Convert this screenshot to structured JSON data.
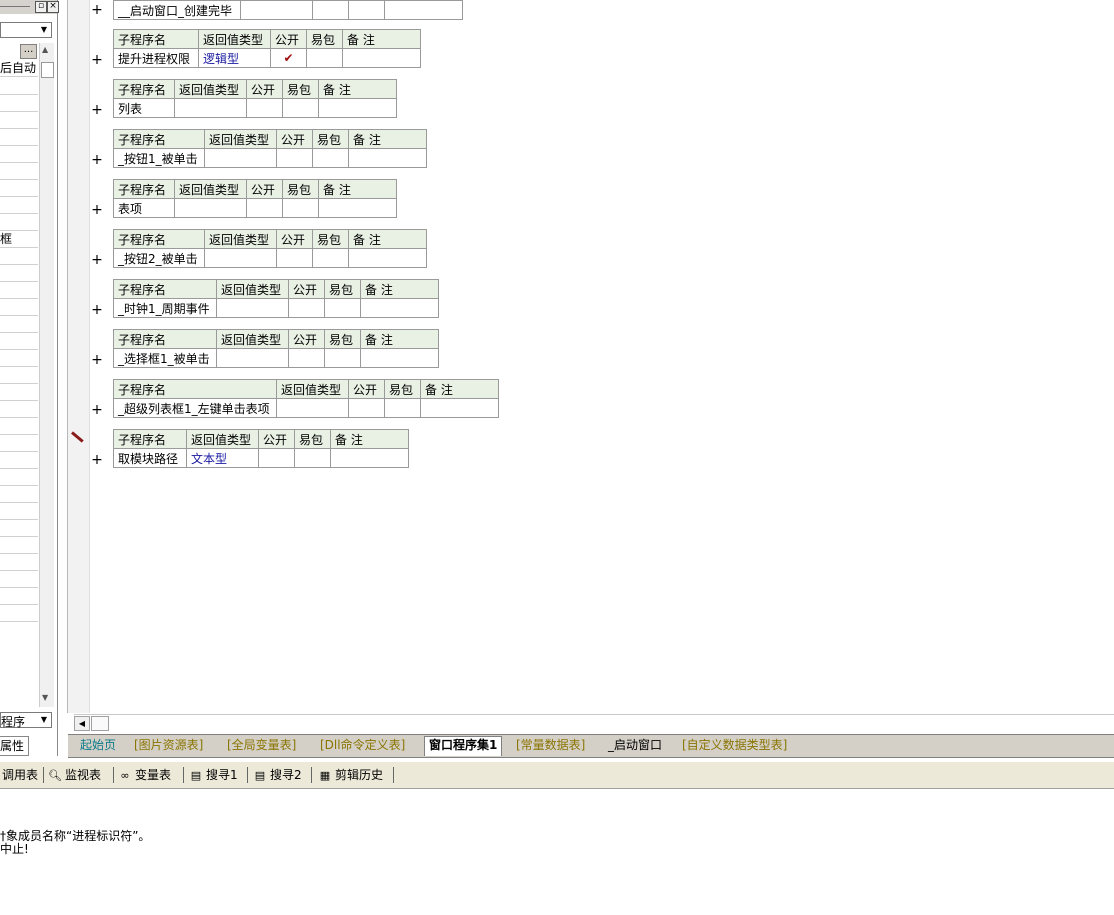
{
  "left_panel": {
    "combo_top": "",
    "ellipsis": "...",
    "item_autostart": "后自动",
    "item_box": "框",
    "combo_bottom": "程序",
    "tab_label": "属性"
  },
  "editor": {
    "header": {
      "name": "子程序名",
      "return_type": "返回值类型",
      "public": "公开",
      "easy_pack": "易包",
      "remark": "备 注"
    },
    "top_row_name": "__启动窗口_创建完毕",
    "plus_symbol": "+",
    "check_symbol": "✔",
    "subroutines": [
      {
        "name": "提升进程权限",
        "return_type": "逻辑型",
        "public": true
      },
      {
        "name": "列表",
        "return_type": "",
        "public": false
      },
      {
        "name": "_按钮1_被单击",
        "return_type": "",
        "public": false
      },
      {
        "name": "表项",
        "return_type": "",
        "public": false
      },
      {
        "name": "_按钮2_被单击",
        "return_type": "",
        "public": false
      },
      {
        "name": "_时钟1_周期事件",
        "return_type": "",
        "public": false
      },
      {
        "name": "_选择框1_被单击",
        "return_type": "",
        "public": false
      },
      {
        "name": "_超级列表框1_左键单击表项",
        "return_type": "",
        "public": false
      },
      {
        "name": "取模块路径",
        "return_type": "文本型",
        "public": false
      }
    ]
  },
  "file_tabs": [
    {
      "label": "起始页",
      "style": "teal"
    },
    {
      "label": "[图片资源表]",
      "style": "yellow"
    },
    {
      "label": "[全局变量表]",
      "style": "yellow"
    },
    {
      "label": "[Dll命令定义表]",
      "style": "yellow"
    },
    {
      "label": "窗口程序集1",
      "style": "active"
    },
    {
      "label": "[常量数据表]",
      "style": "yellow"
    },
    {
      "label": "_启动窗口",
      "style": "normal"
    },
    {
      "label": "[自定义数据类型表]",
      "style": "yellow"
    }
  ],
  "bottom_toolbar": [
    {
      "label": "调用表",
      "icon": ""
    },
    {
      "label": "监视表",
      "icon": "magnifier-icon"
    },
    {
      "label": "变量表",
      "icon": "binoculars-icon"
    },
    {
      "label": "搜寻1",
      "icon": "search-doc-icon"
    },
    {
      "label": "搜寻2",
      "icon": "search-doc-icon"
    },
    {
      "label": "剪辑历史",
      "icon": "clipboard-icon"
    }
  ],
  "output": {
    "line1": "†象成员名称“进程标识符”。",
    "line2": "中止!"
  }
}
